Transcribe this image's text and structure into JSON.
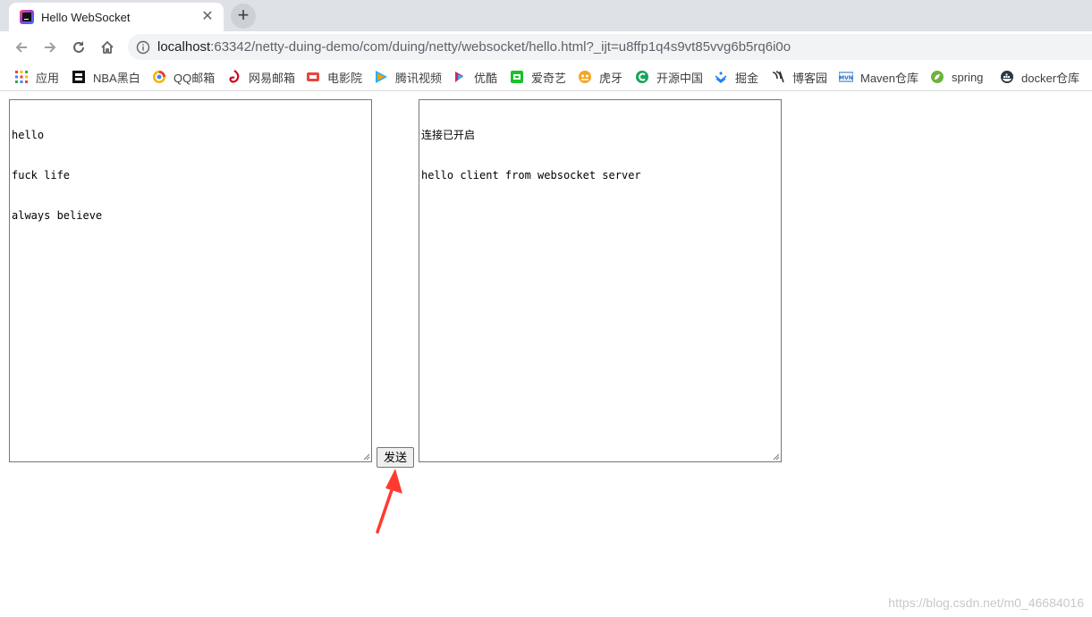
{
  "browser": {
    "tab": {
      "title": "Hello WebSocket",
      "close_glyph": "✕",
      "favicon": "intellij-icon"
    },
    "new_tab_glyph": "+",
    "nav": {
      "back": "back-arrow-icon",
      "forward": "forward-arrow-icon",
      "reload": "reload-icon",
      "home": "home-icon"
    },
    "address": {
      "host": "localhost",
      "path": ":63342/netty-duing-demo/com/duing/netty/websocket/hello.html?_ijt=u8ffp1q4s9vt85vvg6b5rq6i0o"
    },
    "bookmarks": [
      {
        "label": "应用",
        "icon": "apps-grid-icon",
        "color": "#e34234"
      },
      {
        "label": "NBA黑白",
        "icon": "nba-icon",
        "color": "#111111"
      },
      {
        "label": "QQ邮箱",
        "icon": "qqmail-icon",
        "color": "#f4b400"
      },
      {
        "label": "网易邮箱",
        "icon": "netease-mail-icon",
        "color": "#d0021b"
      },
      {
        "label": "电影院",
        "icon": "cinema-icon",
        "color": "#e8453c"
      },
      {
        "label": "腾讯视频",
        "icon": "tencent-video-icon",
        "color": "#20b2f7"
      },
      {
        "label": "优酷",
        "icon": "youku-icon",
        "color": "#e0205f"
      },
      {
        "label": "爱奇艺",
        "icon": "iqiyi-icon",
        "color": "#19c22b"
      },
      {
        "label": "虎牙",
        "icon": "huya-icon",
        "color": "#f5a623"
      },
      {
        "label": "开源中国",
        "icon": "oschina-icon",
        "color": "#1aa35c"
      },
      {
        "label": "掘金",
        "icon": "juejin-icon",
        "color": "#1e80ff"
      },
      {
        "label": "博客园",
        "icon": "cnblogs-icon",
        "color": "#333333"
      },
      {
        "label": "Maven仓库",
        "icon": "maven-icon",
        "color": "#1f6bc1"
      },
      {
        "label": "spring",
        "icon": "spring-icon",
        "color": "#6db33f"
      },
      {
        "label": "docker仓库",
        "icon": "docker-icon",
        "color": "#2d3748"
      }
    ]
  },
  "page": {
    "input_lines": [
      "hello",
      "fuck life",
      "always believe"
    ],
    "output_lines": [
      "连接已开启",
      "hello client from websocket server"
    ],
    "send_button": "发送",
    "watermark": "https://blog.csdn.net/m0_46684016",
    "annotation_arrow_color": "#ff3b30"
  }
}
